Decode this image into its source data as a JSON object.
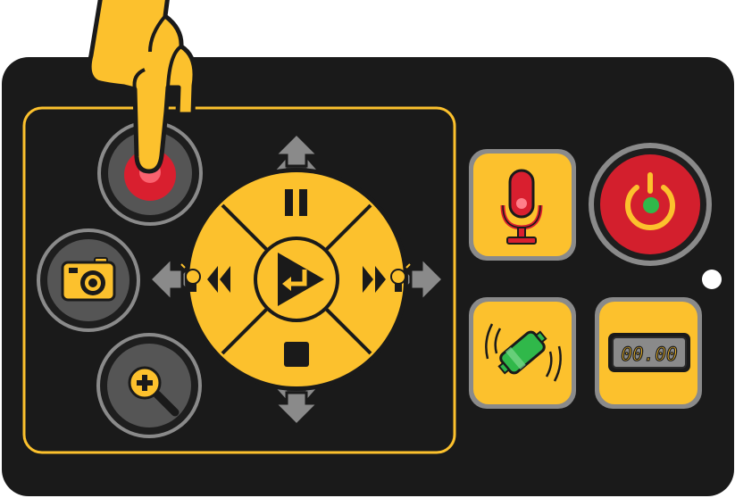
{
  "device": {
    "timer_display": {
      "text": "00.00"
    }
  },
  "colors": {
    "panel": "#1a1a1a",
    "accent": "#fcc12d",
    "ring_gray": "#8a8a8a",
    "dark_gray": "#4a4a4a",
    "record_red": "#d91f2f",
    "power_red": "#d31f2d",
    "led_green": "#30b84a",
    "led_white": "#ffffff"
  },
  "icons": {
    "record": "record-dot-icon",
    "camera": "camera-icon",
    "zoom": "zoom-in-icon",
    "pause": "pause-icon",
    "play": "play-enter-icon",
    "stop": "stop-icon",
    "rewind": "rewind-icon",
    "fast_forward": "fast-forward-icon",
    "microphone": "microphone-icon",
    "vibrate": "vibrate-battery-icon",
    "timer": "timer-display-icon",
    "power": "power-icon",
    "pointer": "pointing-hand-icon"
  }
}
